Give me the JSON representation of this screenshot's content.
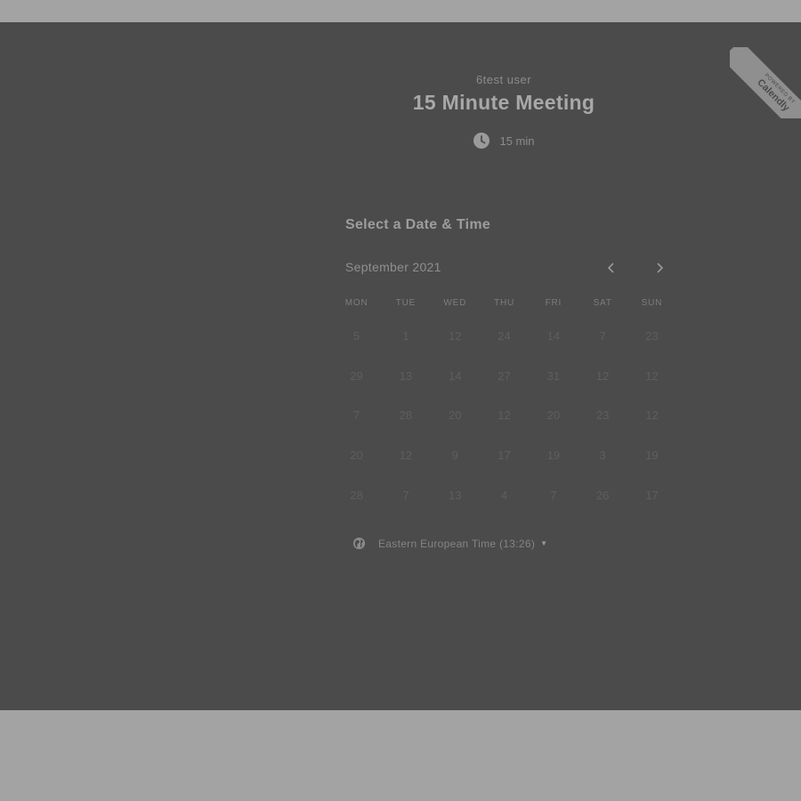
{
  "event": {
    "owner": "6test user",
    "title": "15 Minute Meeting",
    "duration": "15 min"
  },
  "badge": {
    "small_text": "POWERED BY",
    "brand_text": "Calendly"
  },
  "calendar": {
    "section_title": "Select a Date & Time",
    "month": "September 2021",
    "weekdays": [
      "MON",
      "TUE",
      "WED",
      "THU",
      "FRI",
      "SAT",
      "SUN"
    ],
    "weeks": [
      [
        "5",
        "1",
        "12",
        "24",
        "14",
        "7",
        "23"
      ],
      [
        "29",
        "13",
        "14",
        "27",
        "31",
        "12",
        "12"
      ],
      [
        "7",
        "28",
        "20",
        "12",
        "20",
        "23",
        "12"
      ],
      [
        "20",
        "12",
        "9",
        "17",
        "19",
        "3",
        "19"
      ],
      [
        "28",
        "7",
        "13",
        "4",
        "7",
        "26",
        "17"
      ]
    ]
  },
  "timezone": {
    "label": "Eastern European Time (13:26)"
  },
  "icons": {
    "clock": "clock-icon",
    "globe": "globe-icon",
    "prev": "chevron-left-icon",
    "next": "chevron-right-icon",
    "caret": "caret-down-icon"
  }
}
